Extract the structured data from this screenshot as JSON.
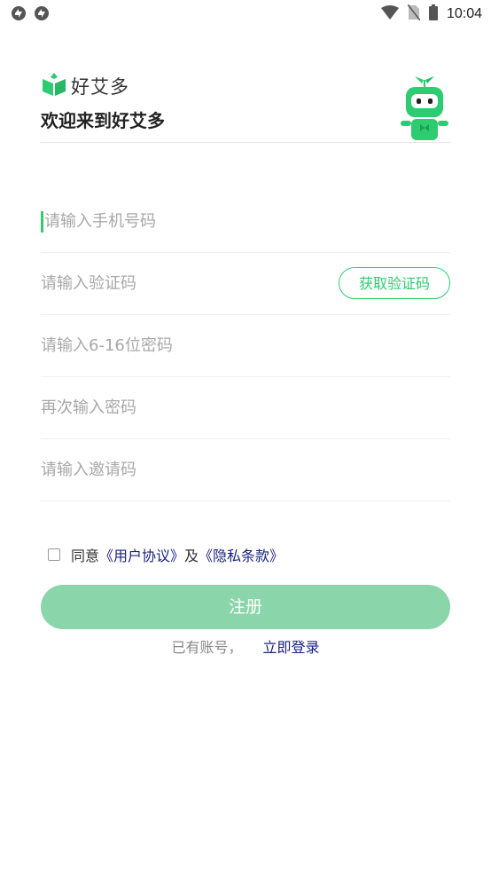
{
  "status_bar": {
    "time": "10:04",
    "left_icons": [
      "sync-icon",
      "sync-icon"
    ],
    "right_icons": [
      "wifi-icon",
      "no-sim-icon",
      "battery-icon"
    ]
  },
  "header": {
    "brand_name": "好艾多",
    "welcome": "欢迎来到好艾多",
    "brand_color": "#2ecc71"
  },
  "form": {
    "phone_placeholder": "请输入手机号码",
    "code_placeholder": "请输入验证码",
    "get_code_label": "获取验证码",
    "password_placeholder": "请输入6-16位密码",
    "confirm_password_placeholder": "再次输入密码",
    "invite_placeholder": "请输入邀请码"
  },
  "agreement": {
    "agree_text": "同意",
    "user_agreement": "《用户协议》",
    "and_text": "及",
    "privacy_policy": "《隐私条款》",
    "checked": false
  },
  "actions": {
    "register_label": "注册",
    "has_account_text": "已有账号，",
    "login_link": "立即登录"
  }
}
